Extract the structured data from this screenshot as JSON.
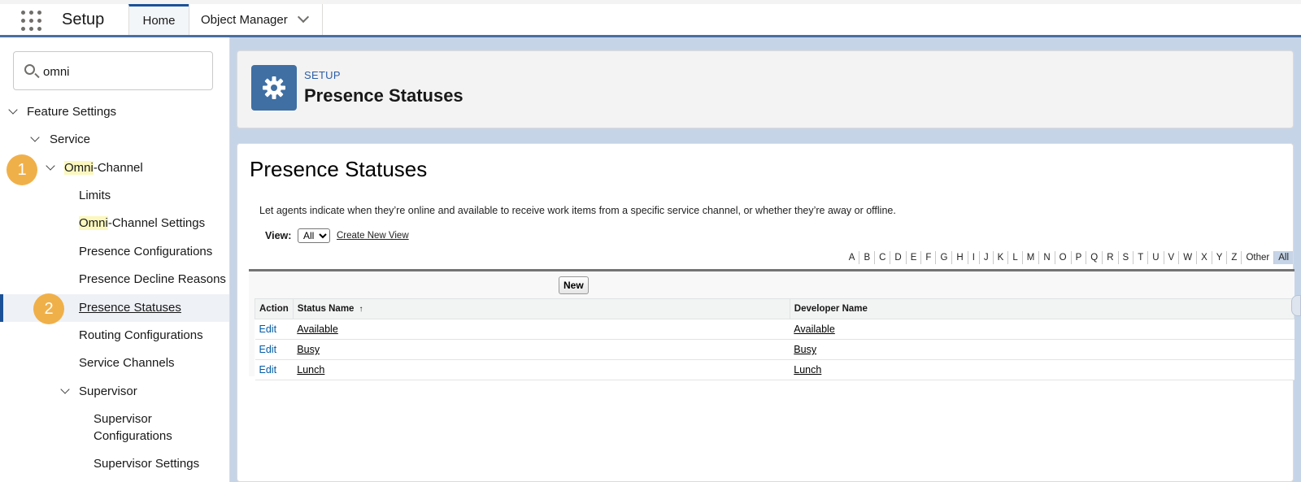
{
  "app": {
    "title": "Setup",
    "tabs": [
      {
        "label": "Home"
      },
      {
        "label": "Object Manager"
      }
    ]
  },
  "sidebar": {
    "search_value": "omni",
    "tree": {
      "feature_settings": "Feature Settings",
      "service": "Service",
      "omni_highlight": "Omni",
      "omni_rest": "-Channel",
      "limits": "Limits",
      "omni_settings_highlight": "Omni",
      "omni_settings_rest": "-Channel Settings",
      "presence_configurations": "Presence Configurations",
      "presence_decline_reasons": "Presence Decline Reasons",
      "presence_statuses": "Presence Statuses",
      "routing_configurations": "Routing Configurations",
      "service_channels": "Service Channels",
      "supervisor": "Supervisor",
      "supervisor_configurations_line1": "Supervisor",
      "supervisor_configurations_line2": "Configurations",
      "supervisor_settings": "Supervisor Settings"
    },
    "badges": [
      "1",
      "2"
    ]
  },
  "header": {
    "eyebrow": "SETUP",
    "title": "Presence Statuses",
    "icon": "gear-icon"
  },
  "content": {
    "title": "Presence Statuses",
    "description": "Let agents indicate when they’re online and available to receive work items from a specific service channel, or whether they’re away or offline.",
    "view_label": "View:",
    "view_selected": "All",
    "create_view": "Create New View",
    "alphabet": [
      "A",
      "B",
      "C",
      "D",
      "E",
      "F",
      "G",
      "H",
      "I",
      "J",
      "K",
      "L",
      "M",
      "N",
      "O",
      "P",
      "Q",
      "R",
      "S",
      "T",
      "U",
      "V",
      "W",
      "X",
      "Y",
      "Z",
      "Other",
      "All"
    ],
    "new_button": "New",
    "table": {
      "headers": {
        "action": "Action",
        "status_name": "Status Name",
        "developer_name": "Developer Name"
      },
      "sort_indicator": "↑",
      "rows": [
        {
          "action": "Edit",
          "status_name": "Available",
          "developer_name": "Available"
        },
        {
          "action": "Edit",
          "status_name": "Busy",
          "developer_name": "Busy"
        },
        {
          "action": "Edit",
          "status_name": "Lunch",
          "developer_name": "Lunch"
        }
      ]
    }
  },
  "colors": {
    "accent": "#1b5297",
    "badge": "#f0b049",
    "highlight": "#fbf7bf",
    "setup_icon_bg": "#3f6fa3"
  }
}
